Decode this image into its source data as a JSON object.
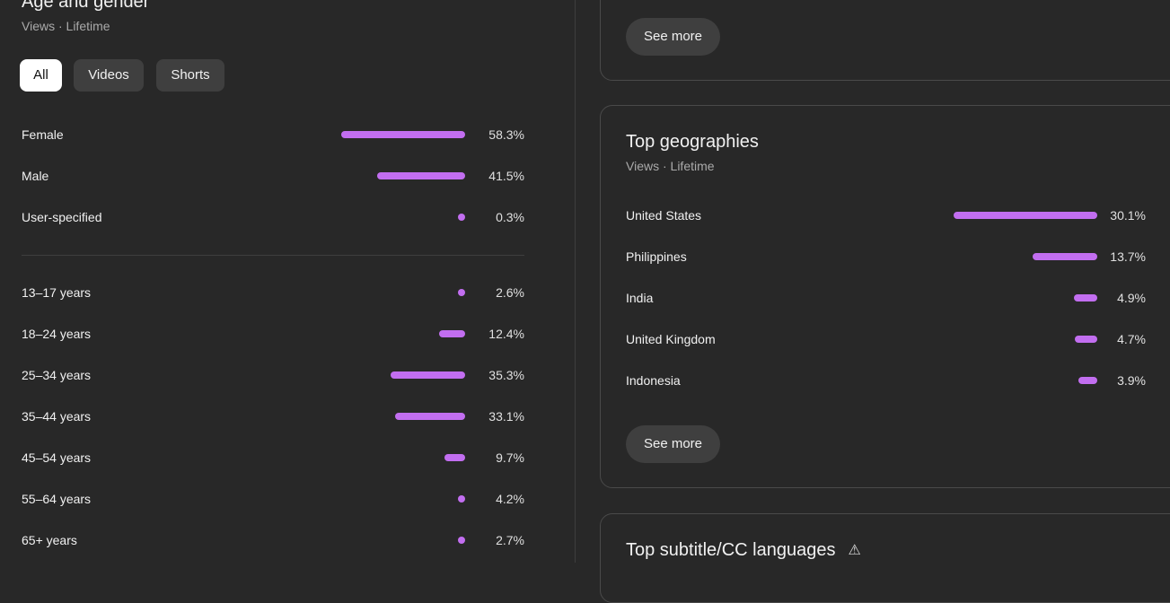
{
  "age_gender": {
    "title": "Age and gender",
    "subtitle": "Views · Lifetime",
    "filters": [
      {
        "label": "All",
        "active": true
      },
      {
        "label": "Videos",
        "active": false
      },
      {
        "label": "Shorts",
        "active": false
      }
    ],
    "gender": [
      {
        "label": "Female",
        "value": "58.3%",
        "pct": 58.3
      },
      {
        "label": "Male",
        "value": "41.5%",
        "pct": 41.5
      },
      {
        "label": "User-specified",
        "value": "0.3%",
        "pct": 0.3
      }
    ],
    "ages": [
      {
        "label": "13–17 years",
        "value": "2.6%",
        "pct": 2.6
      },
      {
        "label": "18–24 years",
        "value": "12.4%",
        "pct": 12.4
      },
      {
        "label": "25–34 years",
        "value": "35.3%",
        "pct": 35.3
      },
      {
        "label": "35–44 years",
        "value": "33.1%",
        "pct": 33.1
      },
      {
        "label": "45–54 years",
        "value": "9.7%",
        "pct": 9.7
      },
      {
        "label": "55–64 years",
        "value": "4.2%",
        "pct": 4.2
      },
      {
        "label": "65+ years",
        "value": "2.7%",
        "pct": 2.7
      }
    ]
  },
  "top_card": {
    "see_more": "See more"
  },
  "geographies": {
    "title": "Top geographies",
    "subtitle": "Views · Lifetime",
    "rows": [
      {
        "label": "United States",
        "value": "30.1%",
        "pct": 30.1
      },
      {
        "label": "Philippines",
        "value": "13.7%",
        "pct": 13.7
      },
      {
        "label": "India",
        "value": "4.9%",
        "pct": 4.9
      },
      {
        "label": "United Kingdom",
        "value": "4.7%",
        "pct": 4.7
      },
      {
        "label": "Indonesia",
        "value": "3.9%",
        "pct": 3.9
      }
    ],
    "see_more": "See more"
  },
  "subtitle_languages": {
    "title": "Top subtitle/CC languages",
    "icon": "warning-icon"
  },
  "colors": {
    "background": "#282828",
    "bar": "#c26ef0",
    "chip_active": "#ffffff",
    "chip": "#3f3f3f"
  }
}
